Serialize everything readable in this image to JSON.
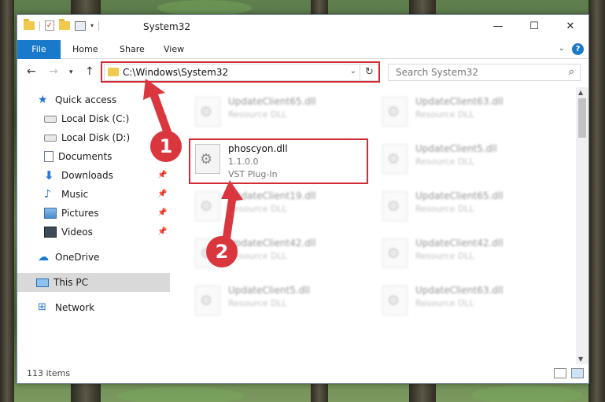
{
  "window": {
    "title": "System32",
    "controls": {
      "minimize": "—",
      "maximize": "☐",
      "close": "✕"
    }
  },
  "ribbon": {
    "file": "File",
    "home": "Home",
    "share": "Share",
    "view": "View"
  },
  "nav": {
    "address": "C:\\Windows\\System32",
    "search_placeholder": "Search System32"
  },
  "sidebar": {
    "items": [
      {
        "label": "Quick access",
        "icon": "star-icon"
      },
      {
        "label": "Local Disk (C:)",
        "icon": "disk-icon"
      },
      {
        "label": "Local Disk (D:)",
        "icon": "disk-icon"
      },
      {
        "label": "Documents",
        "icon": "documents-icon"
      },
      {
        "label": "Downloads",
        "icon": "downloads-icon"
      },
      {
        "label": "Music",
        "icon": "music-icon"
      },
      {
        "label": "Pictures",
        "icon": "pictures-icon"
      },
      {
        "label": "Videos",
        "icon": "videos-icon"
      },
      {
        "label": "OneDrive",
        "icon": "onedrive-icon"
      },
      {
        "label": "This PC",
        "icon": "pc-icon",
        "selected": true
      },
      {
        "label": "Network",
        "icon": "network-icon"
      }
    ]
  },
  "files": {
    "highlighted": {
      "name": "phoscyon.dll",
      "version": "1.1.0.0",
      "description": "VST Plug-In"
    },
    "blurred": [
      {
        "name": "UpdateClient65.dll",
        "type": "Resource DLL"
      },
      {
        "name": "UpdateClient63.dll",
        "type": "Resource DLL"
      },
      {
        "name": "UpdateClient5.dll",
        "type": "Resource DLL"
      },
      {
        "name": "UpdateClient19.dll",
        "type": "Resource DLL"
      },
      {
        "name": "UpdateClient65.dll",
        "type": "Resource DLL"
      },
      {
        "name": "UpdateClient42.dll",
        "type": "Resource DLL"
      },
      {
        "name": "UpdateClient42.dll",
        "type": "Resource DLL"
      },
      {
        "name": "UpdateClient5.dll",
        "type": "Resource DLL"
      },
      {
        "name": "UpdateClient63.dll",
        "type": "Resource DLL"
      }
    ]
  },
  "status": {
    "count": "113 items"
  },
  "annotations": {
    "step1": "1",
    "step2": "2"
  },
  "colors": {
    "accent": "#1979ca",
    "annotation": "#d12b35"
  }
}
